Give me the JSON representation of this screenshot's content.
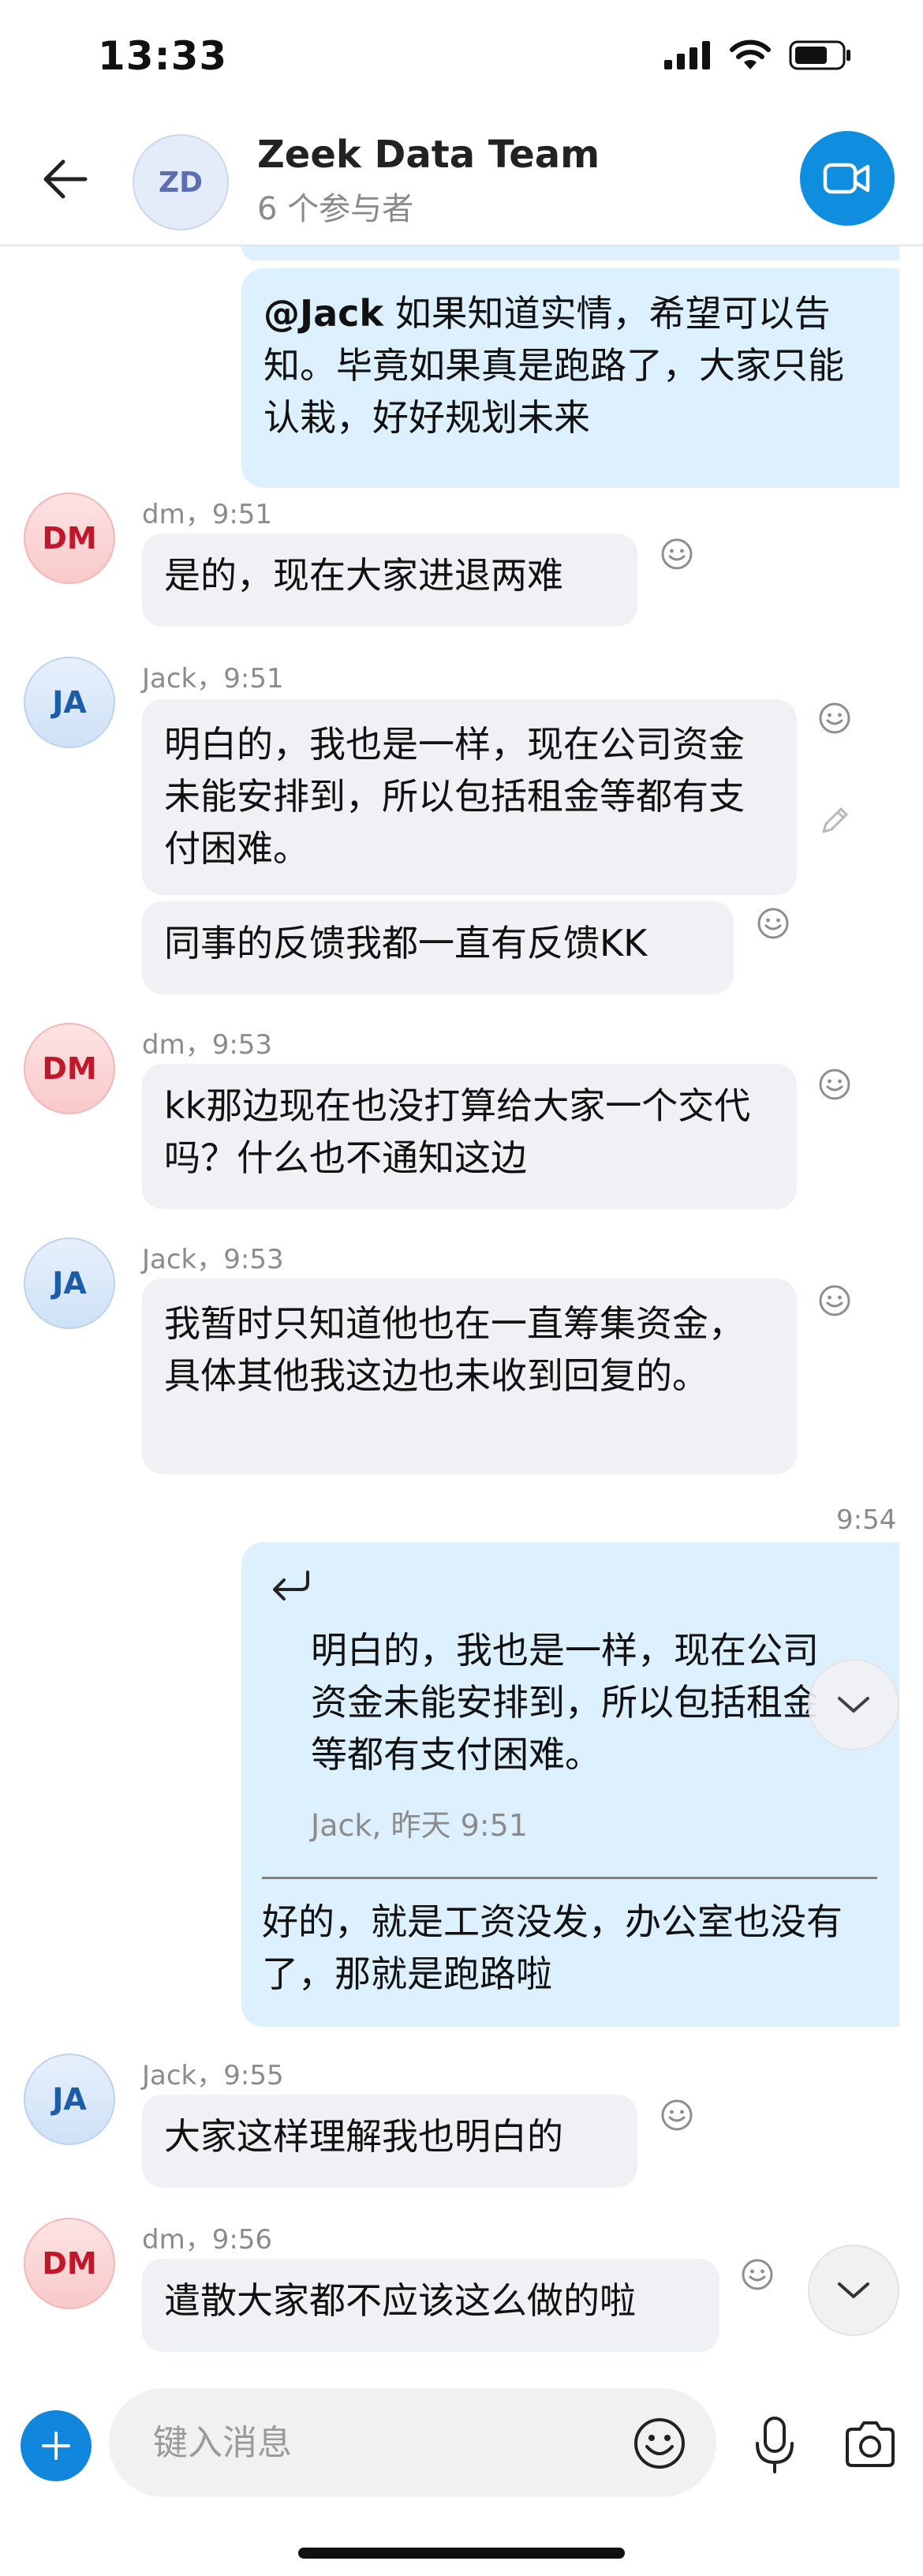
{
  "status": {
    "time": "13:33"
  },
  "header": {
    "avatar_initials": "ZD",
    "title": "Zeek Data Team",
    "subtitle": "6 个参与者"
  },
  "messages": [
    {
      "id": "m0",
      "mention": "@Jack",
      "text": " 如果知道实情，希望可以告知。毕竟如果真是跑路了，大家只能认栽，好好规划未来"
    },
    {
      "id": "m1",
      "sender": "dm",
      "meta": "dm，9:51",
      "avatar": "DM",
      "text": "是的，现在大家进退两难"
    },
    {
      "id": "m2",
      "sender": "Jack",
      "meta": "Jack，9:51",
      "avatar": "JA",
      "text": "明白的，我也是一样，现在公司资金未能安排到，所以包括租金等都有支付困难。"
    },
    {
      "id": "m3",
      "sender": "Jack",
      "text": "同事的反馈我都一直有反馈KK"
    },
    {
      "id": "m4",
      "sender": "dm",
      "meta": "dm，9:53",
      "avatar": "DM",
      "text": "kk那边现在也没打算给大家一个交代吗？什么也不通知这边"
    },
    {
      "id": "m5",
      "sender": "Jack",
      "meta": "Jack，9:53",
      "avatar": "JA",
      "text": "我暂时只知道他也在一直筹集资金，具体其他我这边也未收到回复的。"
    },
    {
      "id": "m6",
      "time": "9:54",
      "quote": {
        "text": "明白的，我也是一样，现在公司资金未能安排到，所以包括租金等都有支付困难。",
        "meta": "Jack, 昨天 9:51"
      },
      "text": "好的，就是工资没发，办公室也没有了，那就是跑路啦"
    },
    {
      "id": "m7",
      "sender": "Jack",
      "meta": "Jack，9:55",
      "avatar": "JA",
      "text": "大家这样理解我也明白的"
    },
    {
      "id": "m8",
      "sender": "dm",
      "meta": "dm，9:56",
      "avatar": "DM",
      "text": "遣散大家都不应该这么做的啦"
    }
  ],
  "composer": {
    "placeholder": "键入消息"
  }
}
